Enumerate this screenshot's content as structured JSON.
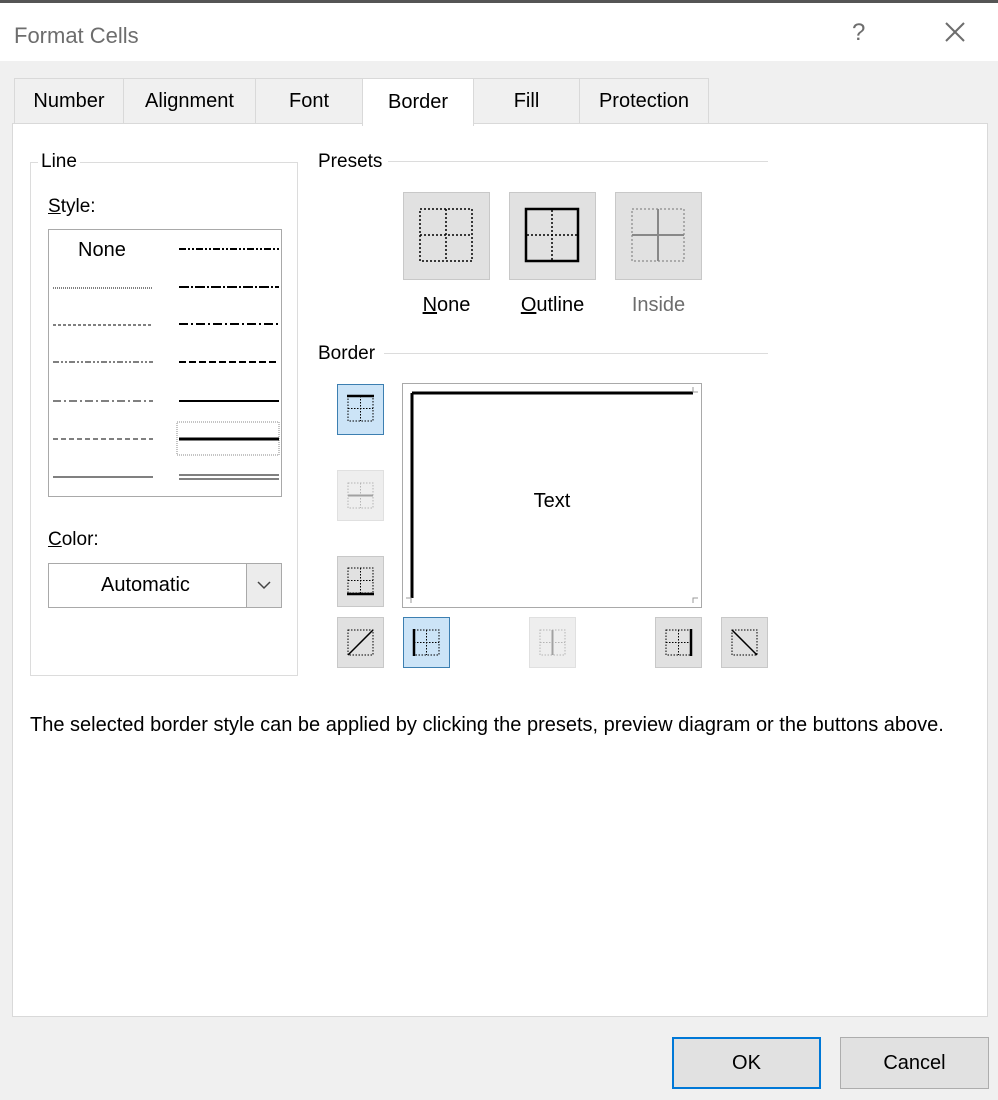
{
  "window": {
    "title": "Format Cells",
    "help": "?"
  },
  "tabs": [
    {
      "label": "Number"
    },
    {
      "label": "Alignment"
    },
    {
      "label": "Font"
    },
    {
      "label": "Border",
      "active": true
    },
    {
      "label": "Fill"
    },
    {
      "label": "Protection"
    }
  ],
  "line": {
    "group_label": "Line",
    "style_label_key": "S",
    "style_label_rest": "tyle:",
    "style_none": "None",
    "color_label_key": "C",
    "color_label_rest": "olor:",
    "color_value": "Automatic"
  },
  "presets": {
    "group_label": "Presets",
    "items": [
      {
        "key": "N",
        "rest": "one",
        "icon": "preset-none-icon"
      },
      {
        "key": "O",
        "rest": "utline",
        "icon": "preset-outline-icon"
      },
      {
        "label": "Inside",
        "icon": "preset-inside-icon",
        "disabled": true
      }
    ]
  },
  "border": {
    "group_label": "Border",
    "preview_text": "Text"
  },
  "description": "The selected border style can be applied by clicking the presets, preview diagram or the buttons above.",
  "buttons": {
    "ok": "OK",
    "cancel": "Cancel"
  },
  "colors": {
    "accent": "#0078d7",
    "selected_bg": "#cce4f7",
    "disabled_text": "#6d6d6d"
  }
}
